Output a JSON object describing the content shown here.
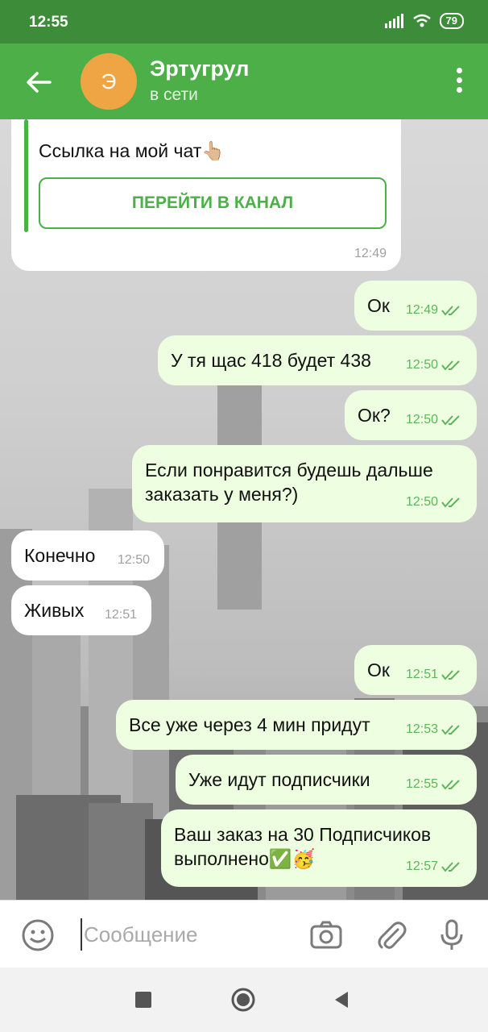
{
  "status": {
    "time": "12:55",
    "battery": "79"
  },
  "header": {
    "avatar_letter": "Э",
    "name": "Эртугрул",
    "status": "в сети"
  },
  "channel_card": {
    "text": "Ссылка на мой чат👆🏼",
    "button_label": "ПЕРЕЙТИ В КАНАЛ",
    "time": "12:49"
  },
  "messages": [
    {
      "dir": "out",
      "text": "Ок",
      "time": "12:49"
    },
    {
      "dir": "out",
      "text": "У тя щас  418 будет 438",
      "time": "12:50"
    },
    {
      "dir": "out",
      "text": "Ок?",
      "time": "12:50"
    },
    {
      "dir": "out",
      "text": "Если понравится будешь дальше заказать у меня?)",
      "time": "12:50"
    },
    {
      "dir": "in",
      "text": "Конечно",
      "time": "12:50"
    },
    {
      "dir": "in",
      "text": "Живых",
      "time": "12:51"
    },
    {
      "dir": "out",
      "text": "Ок",
      "time": "12:51"
    },
    {
      "dir": "out",
      "text": "Все уже через 4 мин придут",
      "time": "12:53"
    },
    {
      "dir": "out",
      "text": "Уже идут подписчики",
      "time": "12:55"
    },
    {
      "dir": "out",
      "text": "Ваш заказ на 30 Подписчиков выполнено✅🥳",
      "time": "12:57"
    }
  ],
  "composer": {
    "placeholder": "Сообщение"
  },
  "colors": {
    "header": "#4caf47",
    "statusbar": "#3d8c3a",
    "outgoing_bubble": "#eefee0",
    "accent": "#4caf47"
  },
  "icons": [
    "back-arrow-icon",
    "more-vert-icon",
    "emoji-icon",
    "camera-icon",
    "attach-icon",
    "mic-icon",
    "double-check-icon"
  ]
}
